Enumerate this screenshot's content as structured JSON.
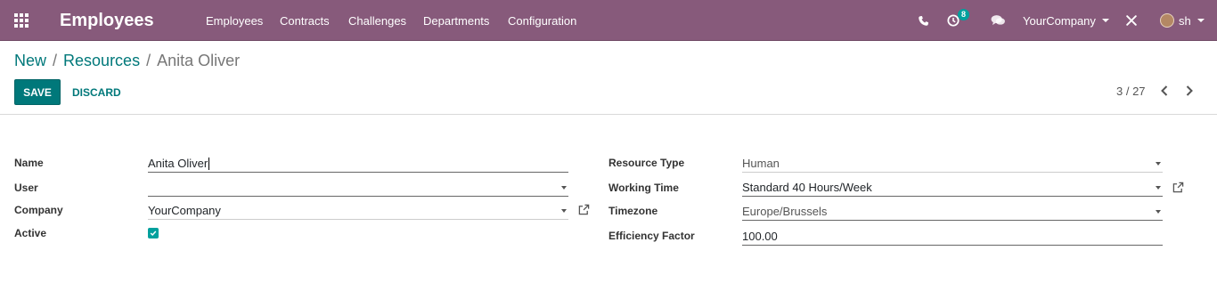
{
  "navbar": {
    "app_title": "Employees",
    "menu": [
      "Employees",
      "Contracts",
      "Challenges",
      "Departments",
      "Configuration"
    ],
    "activity_count": "8",
    "company": "YourCompany",
    "user": "sh",
    "color": "#875a7b"
  },
  "breadcrumb": [
    "New",
    "Resources",
    "Anita Oliver"
  ],
  "buttons": {
    "save": "SAVE",
    "discard": "DISCARD"
  },
  "pager": {
    "value": "3 / 27"
  },
  "form": {
    "name": {
      "label": "Name",
      "value": "Anita Oliver"
    },
    "user": {
      "label": "User",
      "value": ""
    },
    "company": {
      "label": "Company",
      "value": "YourCompany"
    },
    "active": {
      "label": "Active",
      "checked": true
    },
    "resource_type": {
      "label": "Resource Type",
      "value": "Human"
    },
    "working_time": {
      "label": "Working Time",
      "value": "Standard 40 Hours/Week"
    },
    "timezone": {
      "label": "Timezone",
      "value": "Europe/Brussels"
    },
    "efficiency": {
      "label": "Efficiency Factor",
      "value": "100.00"
    }
  },
  "colors": {
    "accent": "#00787a",
    "checkbox": "#00a09d"
  }
}
